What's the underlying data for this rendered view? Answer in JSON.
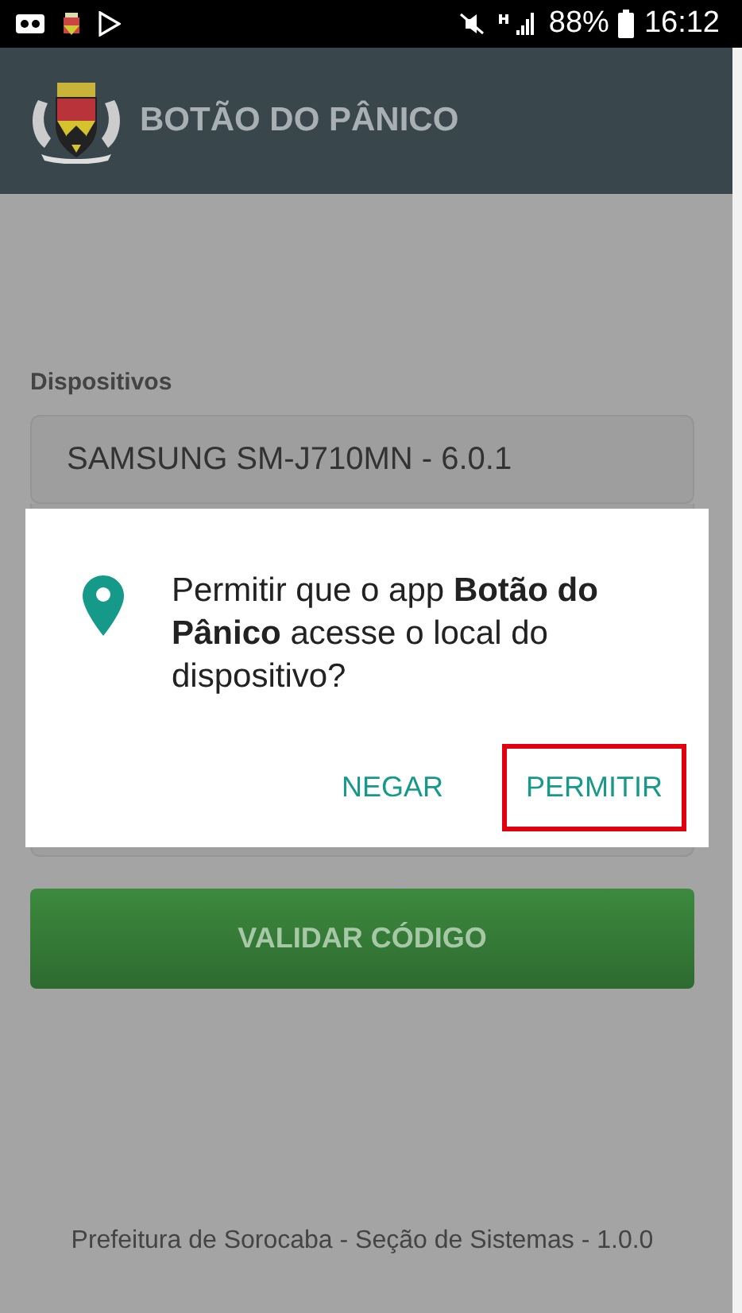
{
  "status_bar": {
    "battery": "88%",
    "time": "16:12"
  },
  "app_bar": {
    "title": "BOTÃO DO PÂNICO"
  },
  "form": {
    "label": "Dispositivos",
    "device_value": "SAMSUNG SM-J710MN - 6.0.1",
    "button": "VALIDAR CÓDIGO"
  },
  "dialog": {
    "message": "Permitir que o app **Botão do Pânico** acesse o local do dispositivo?",
    "buttons": [
      {
        "label": "NEGAR",
        "highlighted": false
      },
      {
        "label": "PERMITIR",
        "highlighted": true
      }
    ]
  },
  "footer": "Prefeitura de Sorocaba - Seção de Sistemas - 1.0.0"
}
